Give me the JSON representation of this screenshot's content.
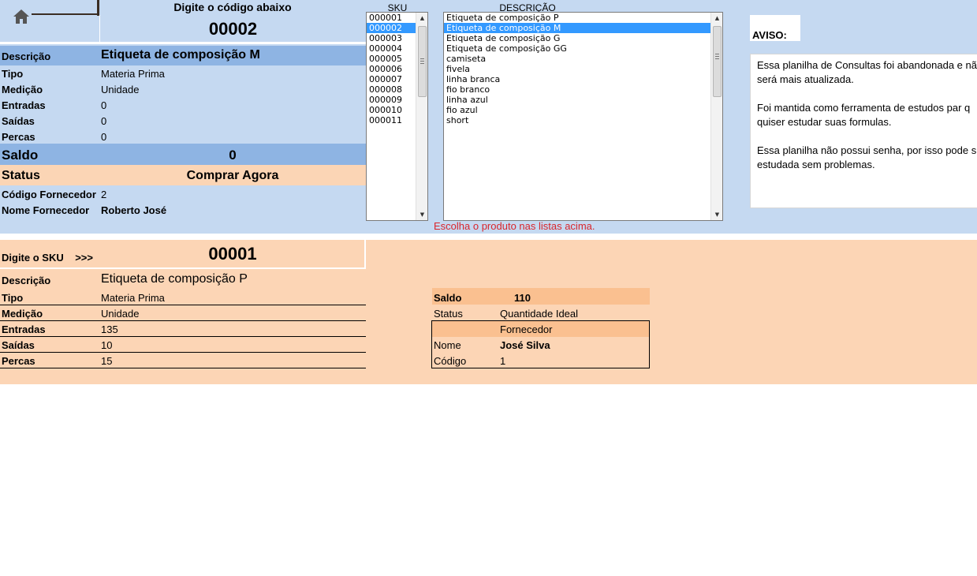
{
  "top": {
    "code_label": "Digite o código abaixo",
    "code_value": "00002",
    "descricao_label": "Descrição",
    "descricao_value": "Etiqueta de composição M",
    "tipo_label": "Tipo",
    "tipo_value": "Materia Prima",
    "medicao_label": "Medição",
    "medicao_value": "Unidade",
    "entradas_label": "Entradas",
    "entradas_value": "0",
    "saidas_label": "Saídas",
    "saidas_value": "0",
    "percas_label": "Percas",
    "percas_value": "0",
    "saldo_label": "Saldo",
    "saldo_value": "0",
    "status_label": "Status",
    "status_value": "Comprar Agora",
    "cod_fornecedor_label": "Código Fornecedor",
    "cod_fornecedor_value": "2",
    "nome_fornecedor_label": "Nome Fornecedor",
    "nome_fornecedor_value": "Roberto José"
  },
  "sku_list": {
    "title": "SKU",
    "items": [
      "000001",
      "000002",
      "000003",
      "000004",
      "000005",
      "000006",
      "000007",
      "000008",
      "000009",
      "000010",
      "000011"
    ],
    "selected_index": 1
  },
  "desc_list": {
    "title": "DESCRIÇÃO",
    "items": [
      "Etiqueta de composição P",
      "Etiqueta de composição M",
      "Etiqueta de composição G",
      "Etiqueta de composição GG",
      "camiseta",
      "fivela",
      "linha branca",
      "fio branco",
      "linha azul",
      "fio azul",
      "short"
    ],
    "selected_index": 1
  },
  "hint": "Escolha o produto nas listas acima.",
  "aviso": {
    "title": "AVISO:",
    "paragraphs": [
      [
        "Essa planilha de Consultas foi abandonada e nã",
        "será mais atualizada."
      ],
      [
        "Foi mantida como ferramenta de estudos par q",
        "quiser estudar suas formulas."
      ],
      [
        "Essa planilha não possui senha, por isso pode s",
        "estudada sem problemas."
      ]
    ]
  },
  "bottom": {
    "sku_label": "Digite o SKU",
    "sku_arrows": ">>>",
    "sku_value": "00001",
    "descricao_label": "Descrição",
    "descricao_value": "Etiqueta de composição P",
    "tipo_label": "Tipo",
    "tipo_value": "Materia Prima",
    "medicao_label": "Medição",
    "medicao_value": "Unidade",
    "entradas_label": "Entradas",
    "entradas_value": "135",
    "saidas_label": "Saídas",
    "saidas_value": "10",
    "percas_label": "Percas",
    "percas_value": "15",
    "saldo_label": "Saldo",
    "saldo_value": "110",
    "status_label": "Status",
    "status_value": "Quantidade Ideal",
    "fornecedor_header": "Fornecedor",
    "nome_label": "Nome",
    "nome_value": "José Silva",
    "codigo_label": "Código",
    "codigo_value": "1"
  },
  "colors": {
    "top_bg": "#c5d9f1",
    "top_bar": "#8eb4e3",
    "peach": "#fbd5b5",
    "peach_dark": "#fac090",
    "hint_red": "#d9262c",
    "selection": "#3399ff"
  }
}
